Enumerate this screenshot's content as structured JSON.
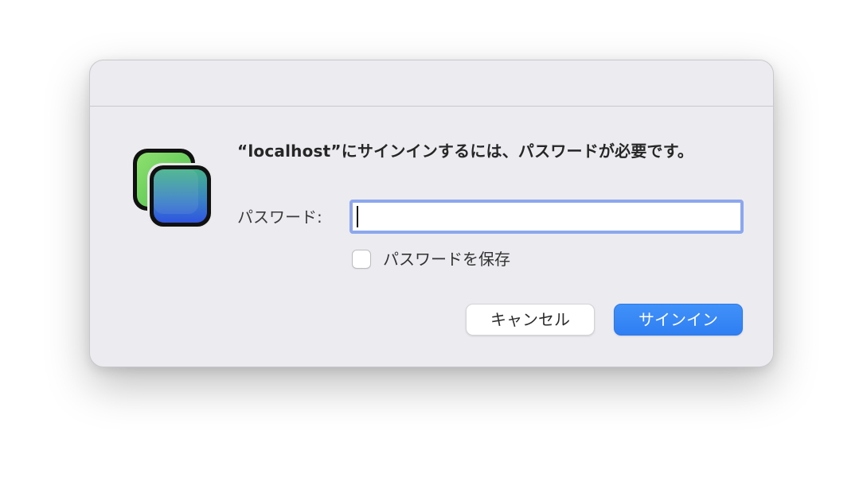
{
  "dialog": {
    "message": "“localhost”にサインインするには、パスワードが必要です。",
    "app_icon": "app-window-stack-icon",
    "password_label": "パスワード:",
    "password_value": "",
    "save_password_label": "パスワードを保存",
    "save_password_checked": false,
    "cancel_label": "キャンセル",
    "signin_label": "サインイン"
  },
  "colors": {
    "background": "#ecebf0",
    "accent": "#2f7ef3",
    "focus_ring": "#8ca7ee"
  }
}
